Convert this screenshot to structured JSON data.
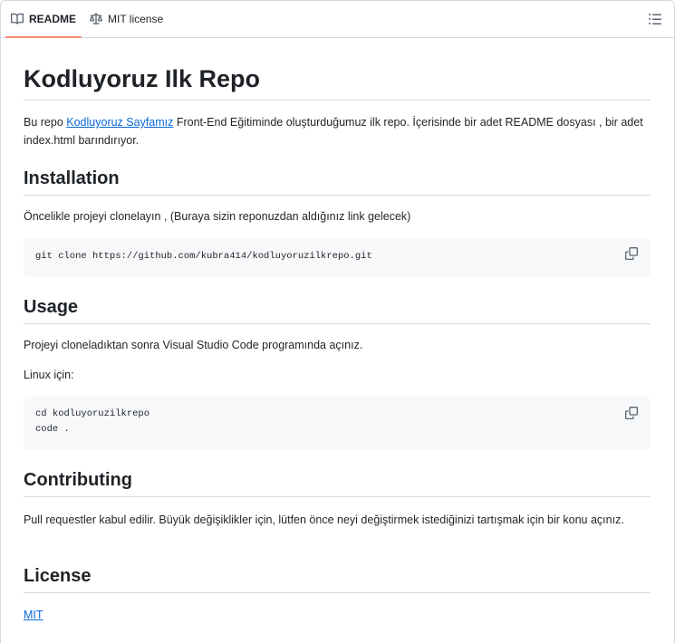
{
  "tabs": {
    "readme": "README",
    "license": "MIT license"
  },
  "readme": {
    "title": "Kodluyoruz Ilk Repo",
    "intro_prefix": "Bu repo ",
    "intro_link": "Kodluyoruz Sayfamız",
    "intro_suffix": " Front-End Eğitiminde oluşturduğumuz ilk repo. İçerisinde bir adet README dosyası , bir adet index.html barındırıyor.",
    "installation": {
      "heading": "Installation",
      "text": "Öncelikle projeyi clonelayın , (Buraya sizin reponuzdan aldığınız link gelecek)",
      "code": [
        "git clone https://github.com/kubra414/kodluyoruzilkrepo.git"
      ]
    },
    "usage": {
      "heading": "Usage",
      "text": "Projeyi cloneladıktan sonra Visual Studio Code programında açınız.",
      "linux_label": "Linux için:",
      "code": [
        "cd kodluyoruzilkrepo",
        "code ."
      ]
    },
    "contributing": {
      "heading": "Contributing",
      "text": "Pull requestler kabul edilir. Büyük değişiklikler için, lütfen önce neyi değiştirmek istediğinizi tartışmak için bir konu açınız."
    },
    "license": {
      "heading": "License",
      "link": "MIT"
    }
  },
  "colors": {
    "link": "#0969da",
    "tab_underline": "#fd8c73",
    "code_bg": "#f6f8fa",
    "border": "#d1d9e0"
  },
  "icons": [
    "book-icon",
    "scale-icon",
    "list-outline-icon",
    "copy-icon"
  ]
}
